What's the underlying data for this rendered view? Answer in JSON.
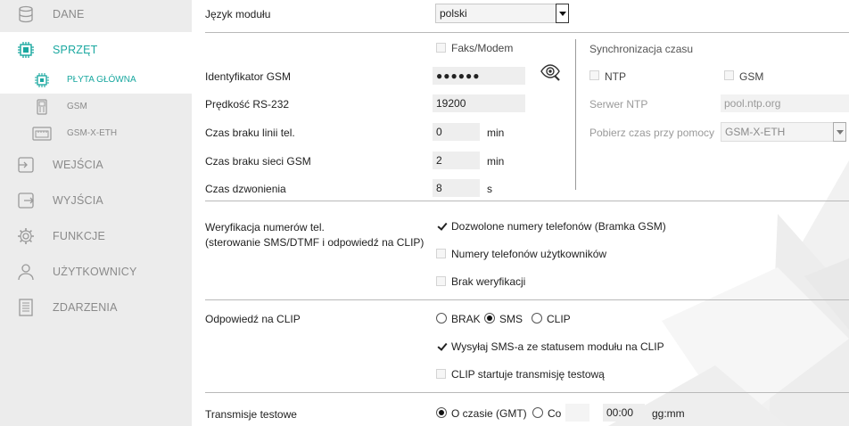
{
  "sidebar": {
    "items": [
      {
        "label": "DANE",
        "icon": "database-icon"
      },
      {
        "label": "SPRZĘT",
        "icon": "chip-icon"
      },
      {
        "label": "WEJŚCIA",
        "icon": "input-icon"
      },
      {
        "label": "WYJŚCIA",
        "icon": "output-icon"
      },
      {
        "label": "FUNKCJE",
        "icon": "gear-icon"
      },
      {
        "label": "UŻYTKOWNICY",
        "icon": "user-icon"
      },
      {
        "label": "ZDARZENIA",
        "icon": "list-icon"
      }
    ],
    "sub_items": [
      {
        "label": "PŁYTA GŁÓWNA",
        "icon": "board-icon"
      },
      {
        "label": "GSM",
        "icon": "phone-icon"
      },
      {
        "label": "GSM-X-ETH",
        "icon": "ethernet-module-icon"
      }
    ],
    "accent_color": "#1aa8a0"
  },
  "module_language": {
    "label": "Język modułu",
    "value": "polski"
  },
  "fax_modem": {
    "label": "Faks/Modem",
    "checked": false
  },
  "gsm_id": {
    "label": "Identyfikator GSM",
    "value": "●●●●●●",
    "icon": "eye-icon"
  },
  "rs232_speed": {
    "label": "Prędkość RS-232",
    "value": "19200"
  },
  "no_line_time": {
    "label": "Czas braku linii tel.",
    "value": "0",
    "unit": "min"
  },
  "no_gsm_time": {
    "label": "Czas braku sieci GSM",
    "value": "2",
    "unit": "min"
  },
  "ring_time": {
    "label": "Czas dzwonienia",
    "value": "8",
    "unit": "s"
  },
  "time_sync": {
    "title": "Synchronizacja czasu",
    "ntp_label": "NTP",
    "gsm_label": "GSM",
    "ntp_server_label": "Serwer NTP",
    "ntp_server_value": "pool.ntp.org",
    "fetch_label": "Pobierz czas przy pomocy",
    "fetch_value": "GSM-X-ETH"
  },
  "verification": {
    "label_line1": "Weryfikacja numerów tel.",
    "label_line2": "(sterowanie SMS/DTMF i odpowiedź na CLIP)",
    "options": [
      {
        "label": "Dozwolone numery telefonów (Bramka GSM)",
        "checked": true
      },
      {
        "label": "Numery telefonów użytkowników",
        "checked": false
      },
      {
        "label": "Brak weryfikacji",
        "checked": false
      }
    ]
  },
  "clip_response": {
    "label": "Odpowiedź na CLIP",
    "options": [
      "BRAK",
      "SMS",
      "CLIP"
    ],
    "selected": "SMS",
    "send_sms_label": "Wysyłaj SMS-a ze statusem modułu na CLIP",
    "send_sms_checked": true,
    "clip_test_label": "CLIP startuje transmisję testową",
    "clip_test_checked": false
  },
  "test_transmissions": {
    "label": "Transmisje testowe",
    "option_time": "O czasie (GMT)",
    "option_every": "Co",
    "selected": "O czasie (GMT)",
    "time_value": "00:00",
    "time_unit": "gg:mm"
  }
}
